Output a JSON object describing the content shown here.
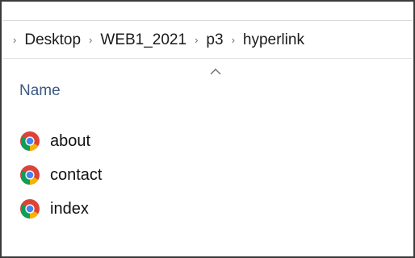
{
  "breadcrumb": {
    "items": [
      {
        "label": "Desktop"
      },
      {
        "label": "WEB1_2021"
      },
      {
        "label": "p3"
      },
      {
        "label": "hyperlink"
      }
    ]
  },
  "columns": {
    "name_label": "Name",
    "sort": "ascending"
  },
  "files": [
    {
      "name": "about",
      "icon": "chrome-icon"
    },
    {
      "name": "contact",
      "icon": "chrome-icon"
    },
    {
      "name": "index",
      "icon": "chrome-icon"
    }
  ]
}
